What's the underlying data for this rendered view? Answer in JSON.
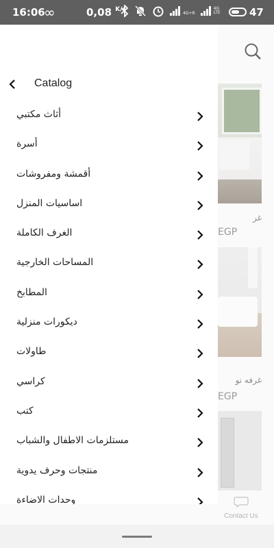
{
  "status_bar": {
    "time": "16:06",
    "infinity": "∞",
    "speed": "0,08",
    "speed_unit": "K/s",
    "network_1": "4G+R",
    "network_2": "4G LTE",
    "battery": "47"
  },
  "background_page": {
    "cards": [
      {
        "title": "غر",
        "price": "EGP"
      },
      {
        "title": "غرفه نو",
        "price": "EGP"
      }
    ],
    "contact_label": "Contact Us"
  },
  "drawer": {
    "title": "Catalog",
    "items": [
      {
        "label": "أثاث مكتبي"
      },
      {
        "label": "أسرة"
      },
      {
        "label": "أقمشة ومفروشات"
      },
      {
        "label": "اساسيات المنزل"
      },
      {
        "label": "الغرف الكاملة"
      },
      {
        "label": "المساحات الخارجية"
      },
      {
        "label": "المطابخ"
      },
      {
        "label": "ديكورات منزلية"
      },
      {
        "label": "طاولات"
      },
      {
        "label": "كراسي"
      },
      {
        "label": "كتب"
      },
      {
        "label": "مستلزمات الاطفال والشباب"
      },
      {
        "label": "منتجات وحرف يدوية"
      },
      {
        "label": "وحدات الاضاءة"
      }
    ]
  }
}
